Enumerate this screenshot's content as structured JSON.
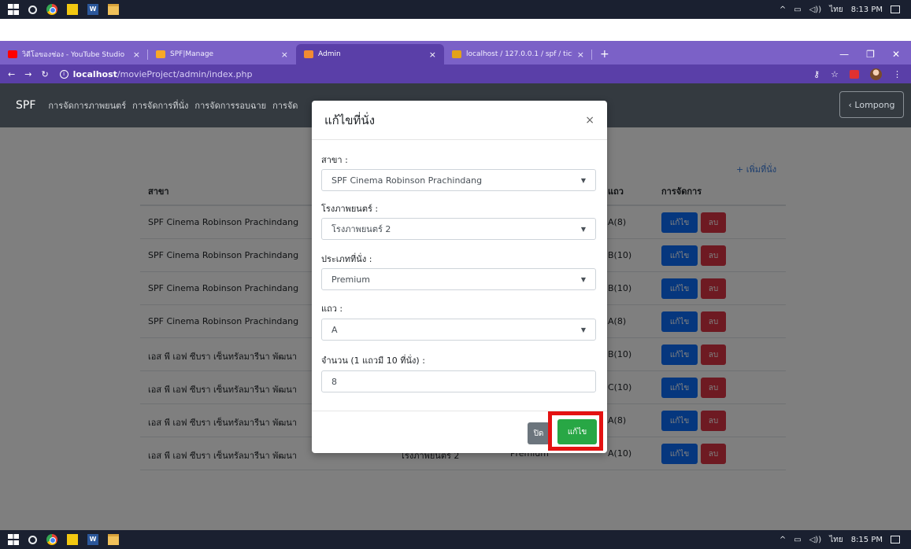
{
  "taskbar_top": {
    "clock": "8:13 PM",
    "lang": "ไทย"
  },
  "taskbar_bottom": {
    "clock": "8:15 PM",
    "lang": "ไทย"
  },
  "browser": {
    "tabs": [
      {
        "title": "วิดีโอของช่อง - YouTube Studio",
        "icon": "youtube-icon"
      },
      {
        "title": "SPF|Manage",
        "icon": "site-icon"
      },
      {
        "title": "Admin",
        "icon": "site-icon",
        "active": true
      },
      {
        "title": "localhost / 127.0.0.1 / spf / ticket",
        "icon": "phpmyadmin-icon"
      }
    ],
    "new_tab": "+",
    "url_host": "localhost",
    "url_path": "/movieProject/admin/index.php"
  },
  "app_nav": {
    "brand": "SPF",
    "items": [
      "การจัดการภาพยนตร์",
      "การจัดการที่นั่ง",
      "การจัดการรอบฉาย",
      "การจัด"
    ],
    "user_button": "‹ Lompong"
  },
  "page": {
    "add_seat": "+ เพิ่มที่นั่ง",
    "headers": {
      "branch": "สาขา",
      "row": "แถว",
      "actions": "การจัดการ"
    },
    "edit_label": "แก้ไข",
    "delete_label": "ลบ",
    "rows": [
      {
        "branch": "SPF Cinema Robinson Prachindang",
        "theater": "",
        "type": "",
        "row": "A(8)"
      },
      {
        "branch": "SPF Cinema Robinson Prachindang",
        "theater": "",
        "type": "",
        "row": "B(10)"
      },
      {
        "branch": "SPF Cinema Robinson Prachindang",
        "theater": "",
        "type": "",
        "row": "B(10)"
      },
      {
        "branch": "SPF Cinema Robinson Prachindang",
        "theater": "",
        "type": "",
        "row": "A(8)"
      },
      {
        "branch": "เอส พี เอฟ ซีบรา เซ็นทรัลมารีนา พัฒนา",
        "theater": "",
        "type": "",
        "row": "B(10)"
      },
      {
        "branch": "เอส พี เอฟ ซีบรา เซ็นทรัลมารีนา พัฒนา",
        "theater": "",
        "type": "",
        "row": "C(10)"
      },
      {
        "branch": "เอส พี เอฟ ซีบรา เซ็นทรัลมารีนา พัฒนา",
        "theater": "",
        "type": "",
        "row": "A(8)"
      },
      {
        "branch": "เอส พี เอฟ ซีบรา เซ็นทรัลมารีนา พัฒนา",
        "theater": "โรงภาพยนตร์ 2",
        "type": "Premium",
        "row": "A(10)"
      }
    ]
  },
  "modal": {
    "title": "แก้ไขที่นั่ง",
    "close_glyph": "×",
    "fields": {
      "branch_label": "สาขา :",
      "branch_value": "SPF Cinema Robinson Prachindang",
      "theater_label": "โรงภาพยนตร์ :",
      "theater_value": "โรงภาพยนตร์ 2",
      "seat_type_label": "ประเภทที่นั่ง :",
      "seat_type_value": "Premium",
      "row_label": "แถว :",
      "row_value": "A",
      "count_label": "จำนวน (1 แถวมี 10 ที่นั่ง) :",
      "count_value": "8"
    },
    "close_button": "ปิด",
    "save_button": "แก้ไข"
  },
  "colors": {
    "highlight": "#e41212",
    "save": "#28a745",
    "edit": "#0d6efd",
    "delete": "#dc3545",
    "tabbar": "#7b61c7"
  }
}
